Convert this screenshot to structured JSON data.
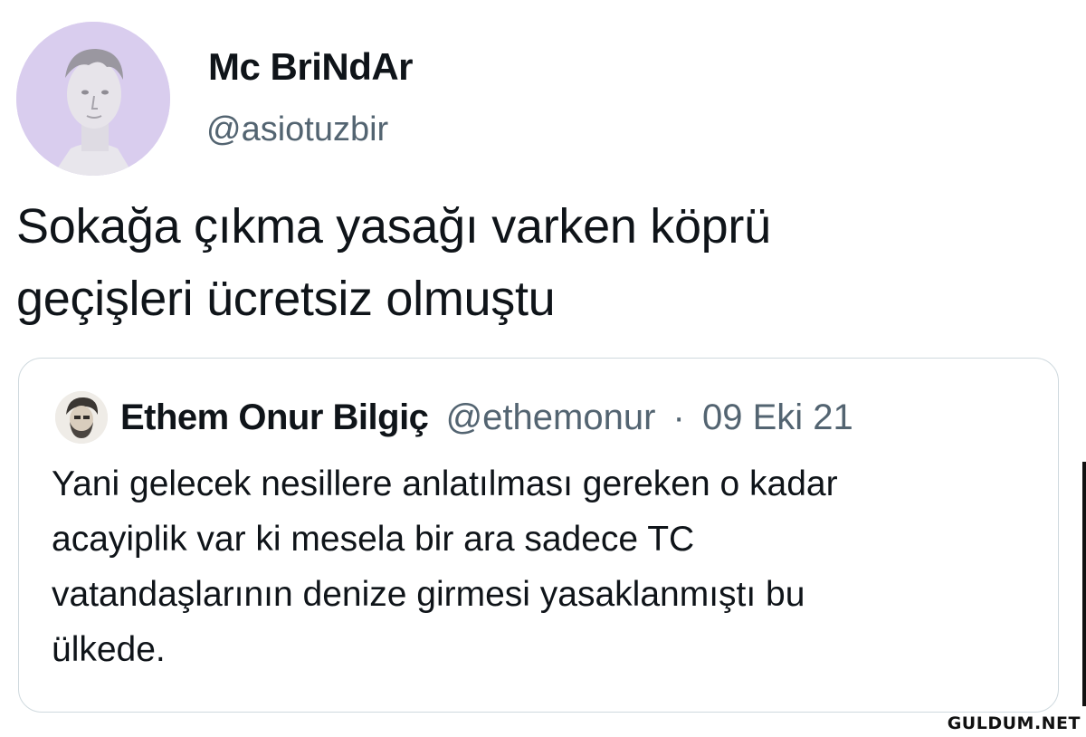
{
  "tweet": {
    "author": {
      "display_name": "Mc BriNdAr",
      "handle": "@asiotuzbir",
      "avatar_icon": "statue-head-avatar-icon"
    },
    "text_lines": [
      "Sokağa çıkma yasağı varken köprü",
      "geçişleri ücretsiz olmuştu"
    ]
  },
  "quoted_tweet": {
    "author": {
      "display_name": "Ethem Onur Bilgiç",
      "handle": "@ethemonur",
      "separator": "·",
      "date": "09 Eki 21",
      "avatar_icon": "profile-sketch-avatar-icon"
    },
    "text_lines": [
      "Yani gelecek nesillere anlatılması gereken o kadar",
      "acayiplik var ki mesela bir ara sadece TC",
      "vatandaşlarının denize girmesi yasaklanmıştı bu",
      "ülkede."
    ]
  },
  "watermark": "GULDUM.NET",
  "colors": {
    "text_primary": "#0f1419",
    "text_secondary": "#536471",
    "border": "#cfd9de",
    "avatar_bg": "#d7c9ee"
  }
}
